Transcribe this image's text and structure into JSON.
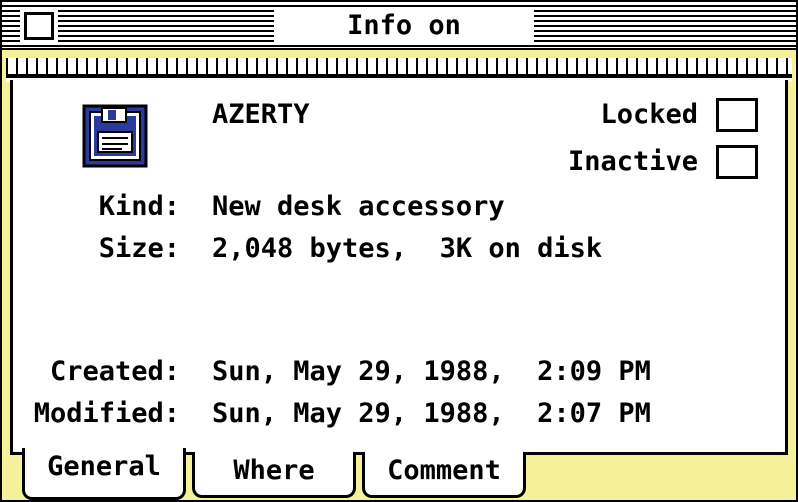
{
  "window": {
    "title": "Info on “AZERTY”"
  },
  "file": {
    "icon": "desk-accessory-file-icon",
    "name": "AZERTY"
  },
  "options": {
    "locked_label": "Locked",
    "locked_checked": false,
    "inactive_label": "Inactive",
    "inactive_checked": false
  },
  "details": {
    "kind_label": "Kind:",
    "kind_value": "New desk accessory",
    "size_label": "Size:",
    "size_value": "2,048 bytes,  3K on disk",
    "created_label": "Created:",
    "created_value": "Sun, May 29, 1988,  2:09 PM",
    "modified_label": "Modified:",
    "modified_value": "Sun, May 29, 1988,  2:07 PM"
  },
  "tabs": [
    {
      "label": "General",
      "active": true
    },
    {
      "label": "Where",
      "active": false
    },
    {
      "label": "Comment",
      "active": false
    }
  ],
  "colors": {
    "frame": "#f5f199",
    "ink": "#000000",
    "paper": "#ffffff",
    "icon_blue": "#2b3a9e"
  }
}
